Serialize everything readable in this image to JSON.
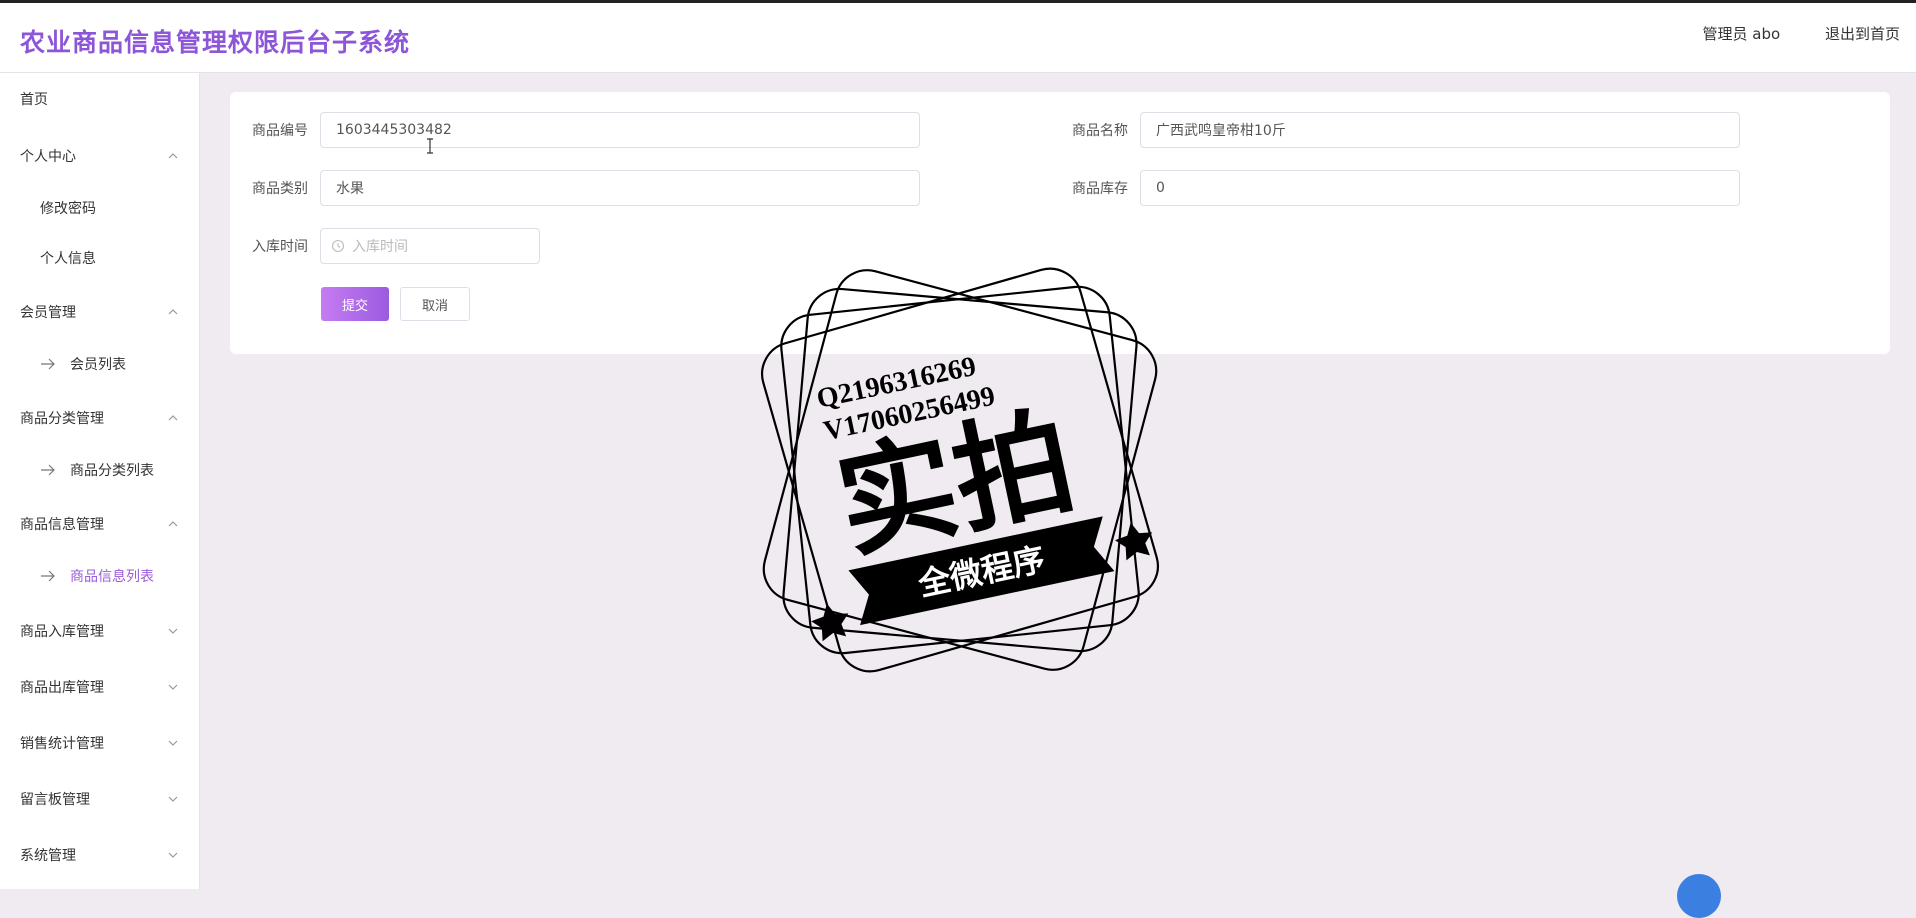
{
  "header": {
    "title": "农业商品信息管理权限后台子系统",
    "user_label": "管理员 abo",
    "logout_label": "退出到首页"
  },
  "sidebar": {
    "items": [
      {
        "label": "首页"
      },
      {
        "label": "个人中心"
      },
      {
        "label": "修改密码"
      },
      {
        "label": "个人信息"
      },
      {
        "label": "会员管理"
      },
      {
        "label": "会员列表"
      },
      {
        "label": "商品分类管理"
      },
      {
        "label": "商品分类列表"
      },
      {
        "label": "商品信息管理"
      },
      {
        "label": "商品信息列表"
      },
      {
        "label": "商品入库管理"
      },
      {
        "label": "商品出库管理"
      },
      {
        "label": "销售统计管理"
      },
      {
        "label": "留言板管理"
      },
      {
        "label": "系统管理"
      }
    ]
  },
  "form": {
    "code": {
      "label": "商品编号",
      "value": "1603445303482"
    },
    "name": {
      "label": "商品名称",
      "value": "广西武鸣皇帝柑10斤"
    },
    "category": {
      "label": "商品类别",
      "value": "水果"
    },
    "stock": {
      "label": "商品库存",
      "value": "0"
    },
    "in_time": {
      "label": "入库时间",
      "placeholder": "入库时间"
    },
    "submit_label": "提交",
    "cancel_label": "取消"
  },
  "watermark": {
    "line1": "Q2196316269",
    "line2": "V17060256499",
    "main": "实拍",
    "banner": "全微程序"
  },
  "colors": {
    "accent": "#9b5cdb",
    "title": "#8d56d8",
    "background": "#efebf0"
  }
}
